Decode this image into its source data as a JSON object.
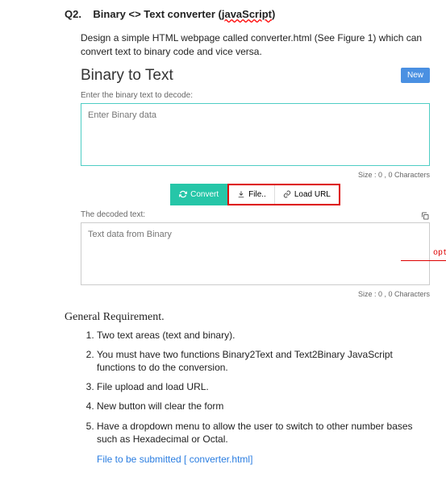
{
  "question": {
    "label": "Q2.",
    "title_a": "Binary <> Text converter (",
    "title_b": "javaScript",
    "title_c": ")"
  },
  "desc": "Design a simple HTML webpage called converter.html (See Figure 1) which can convert text to binary code and vice versa.",
  "fig": {
    "title": "Binary to Text",
    "new_btn": "New",
    "input_label": "Enter the binary text to decode:",
    "input_placeholder": "Enter Binary data",
    "size1": "Size : 0 , 0 Characters",
    "convert": "Convert",
    "file": "File..",
    "load_url": "Load URL",
    "optional": "optional",
    "output_label": "The decoded text:",
    "output_placeholder": "Text data from Binary",
    "size2": "Size : 0 , 0 Characters"
  },
  "gen_req": "General Requirement.",
  "reqs": [
    "Two text areas (text and binary).",
    "You must have two functions Binary2Text and Text2Binary JavaScript functions to do the conversion.",
    "File upload and load URL.",
    "New button will clear the form",
    "Have a dropdown menu to allow the user to switch to other number bases such as Hexadecimal or Octal."
  ],
  "submit": "File to be submitted [ converter.html]"
}
